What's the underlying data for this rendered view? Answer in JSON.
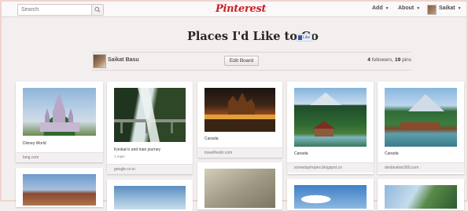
{
  "header": {
    "search_placeholder": "Search",
    "logo_text": "Pinterest",
    "nav": [
      {
        "label": "Add"
      },
      {
        "label": "About"
      },
      {
        "label": "Saikat"
      }
    ],
    "brand_color": "#cb2027"
  },
  "board": {
    "title": "Places I'd Like to Go",
    "like_label": "Like",
    "owner_name": "Saikat Basu",
    "edit_label": "Edit Board",
    "followers_count": "4",
    "followers_word": "followers,",
    "pins_count": "19",
    "pins_word": "pins"
  },
  "pins": [
    {
      "desc": "Disney World",
      "source": "bing.com",
      "icon": "disney-castle-image"
    },
    {
      "desc": "Konkan's and train journey",
      "repins": "1 repin",
      "source": "google.co.in",
      "icon": "waterfall-train-image"
    },
    {
      "desc": "Canada",
      "source": "travelfreshi.com",
      "icon": "quebec-city-night-image"
    },
    {
      "desc": "Canada",
      "source": "somedayhopes.blogspot.co",
      "icon": "mountain-cabin-image"
    },
    {
      "desc": "Canada",
      "source": "destination360.com",
      "icon": "lakeside-lodge-image"
    }
  ]
}
